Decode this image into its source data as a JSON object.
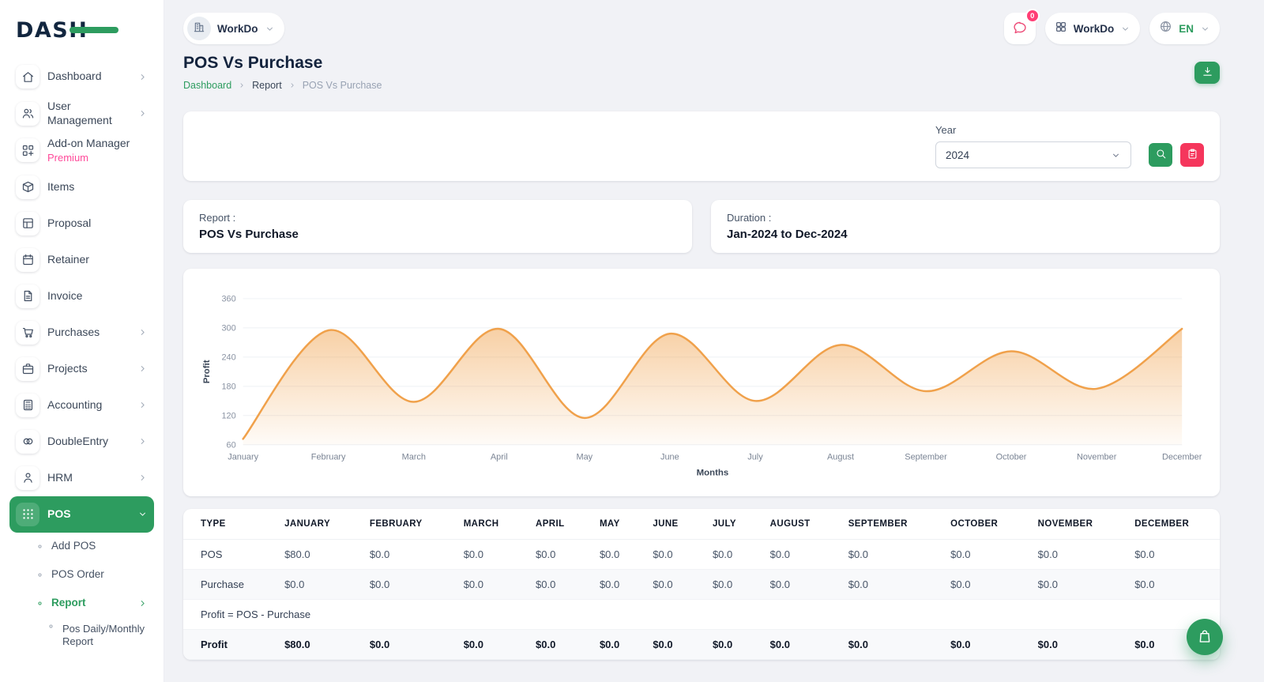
{
  "colors": {
    "accent": "#2d9c5f",
    "pink": "#f5365c",
    "badge": "#ff3e75",
    "chart_line": "#f0a14b",
    "page_bg": "#f1f2f6"
  },
  "brand": {
    "logo_text": "DASH"
  },
  "topbar": {
    "workspace_label": "WorkDo",
    "notification_count": "0",
    "app_label": "WorkDo",
    "language": "EN"
  },
  "header": {
    "title": "POS Vs Purchase",
    "breadcrumb": [
      "Dashboard",
      "Report",
      "POS Vs Purchase"
    ]
  },
  "filter": {
    "year_label": "Year",
    "year_value": "2024"
  },
  "summary": {
    "report_label": "Report :",
    "report_value": "POS Vs Purchase",
    "duration_label": "Duration :",
    "duration_value": "Jan-2024 to Dec-2024"
  },
  "chart_data": {
    "type": "area",
    "title": "",
    "x": [
      "January",
      "February",
      "March",
      "April",
      "May",
      "June",
      "July",
      "August",
      "September",
      "October",
      "November",
      "December"
    ],
    "series": [
      {
        "name": "Profit",
        "values": [
          72,
          295,
          148,
          298,
          115,
          288,
          150,
          265,
          170,
          252,
          175,
          298
        ]
      }
    ],
    "xlabel": "Months",
    "ylabel": "Profit",
    "ylim": [
      60,
      360
    ],
    "yticks": [
      60,
      120,
      180,
      240,
      300,
      360
    ],
    "smooth": true,
    "grid": true,
    "legend": "none",
    "line_color": "#f0a14b",
    "fill": "vertical gradient from line color to transparent"
  },
  "table": {
    "columns": [
      "TYPE",
      "JANUARY",
      "FEBRUARY",
      "MARCH",
      "APRIL",
      "MAY",
      "JUNE",
      "JULY",
      "AUGUST",
      "SEPTEMBER",
      "OCTOBER",
      "NOVEMBER",
      "DECEMBER"
    ],
    "rows": [
      {
        "type": "POS",
        "values": [
          "$80.0",
          "$0.0",
          "$0.0",
          "$0.0",
          "$0.0",
          "$0.0",
          "$0.0",
          "$0.0",
          "$0.0",
          "$0.0",
          "$0.0",
          "$0.0"
        ]
      },
      {
        "type": "Purchase",
        "values": [
          "$0.0",
          "$0.0",
          "$0.0",
          "$0.0",
          "$0.0",
          "$0.0",
          "$0.0",
          "$0.0",
          "$0.0",
          "$0.0",
          "$0.0",
          "$0.0"
        ]
      },
      {
        "note": "Profit = POS - Purchase"
      },
      {
        "type": "Profit",
        "bold": true,
        "values": [
          "$80.0",
          "$0.0",
          "$0.0",
          "$0.0",
          "$0.0",
          "$0.0",
          "$0.0",
          "$0.0",
          "$0.0",
          "$0.0",
          "$0.0",
          "$0.0"
        ]
      }
    ]
  },
  "sidebar": {
    "items": [
      {
        "label": "Dashboard",
        "icon": "home-icon",
        "chevron": "right"
      },
      {
        "label": "User Management",
        "icon": "users-icon",
        "chevron": "right"
      },
      {
        "label": "Add-on Manager",
        "sublabel": "Premium",
        "icon": "addon-icon"
      },
      {
        "label": "Items",
        "icon": "items-icon"
      },
      {
        "label": "Proposal",
        "icon": "proposal-icon"
      },
      {
        "label": "Retainer",
        "icon": "retainer-icon"
      },
      {
        "label": "Invoice",
        "icon": "invoice-icon"
      },
      {
        "label": "Purchases",
        "icon": "purchases-icon",
        "chevron": "right"
      },
      {
        "label": "Projects",
        "icon": "projects-icon",
        "chevron": "right"
      },
      {
        "label": "Accounting",
        "icon": "accounting-icon",
        "chevron": "right"
      },
      {
        "label": "DoubleEntry",
        "icon": "doubleentry-icon",
        "chevron": "right"
      },
      {
        "label": "HRM",
        "icon": "hrm-icon",
        "chevron": "right"
      },
      {
        "label": "POS",
        "icon": "pos-icon",
        "chevron": "down",
        "active": true
      },
      {
        "label": "Add POS",
        "type": "sub"
      },
      {
        "label": "POS Order",
        "type": "sub"
      },
      {
        "label": "Report",
        "type": "sub",
        "active": true,
        "chevron": "right"
      },
      {
        "label": "Pos Daily/Monthly Report",
        "type": "subsub"
      }
    ]
  }
}
